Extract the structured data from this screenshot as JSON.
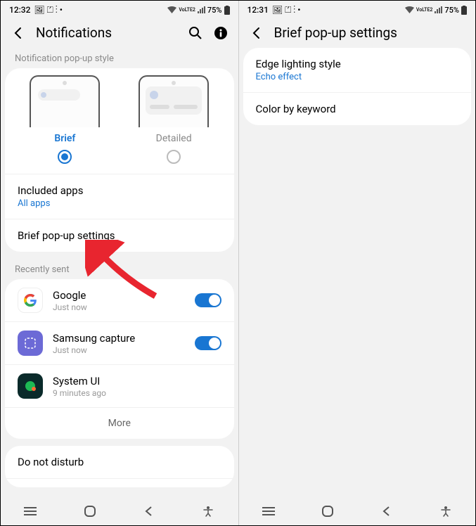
{
  "left": {
    "status": {
      "time": "12:32",
      "battery": "75%",
      "net": "VoLTE2"
    },
    "header": {
      "title": "Notifications"
    },
    "section_popup": "Notification pop-up style",
    "popup": {
      "brief_label": "Brief",
      "detailed_label": "Detailed"
    },
    "included": {
      "title": "Included apps",
      "sub": "All apps"
    },
    "brief_settings": "Brief pop-up settings",
    "section_recent": "Recently sent",
    "apps": [
      {
        "name": "Google",
        "time": "Just now",
        "toggle": true
      },
      {
        "name": "Samsung capture",
        "time": "Just now",
        "toggle": true
      },
      {
        "name": "System UI",
        "time": "9 minutes ago",
        "toggle": false
      }
    ],
    "more": "More",
    "dnd": "Do not disturb"
  },
  "right": {
    "status": {
      "time": "12:31",
      "battery": "75%",
      "net": "VoLTE2"
    },
    "header": {
      "title": "Brief pop-up settings"
    },
    "edge": {
      "title": "Edge lighting style",
      "sub": "Echo effect"
    },
    "color": {
      "title": "Color by keyword"
    }
  }
}
